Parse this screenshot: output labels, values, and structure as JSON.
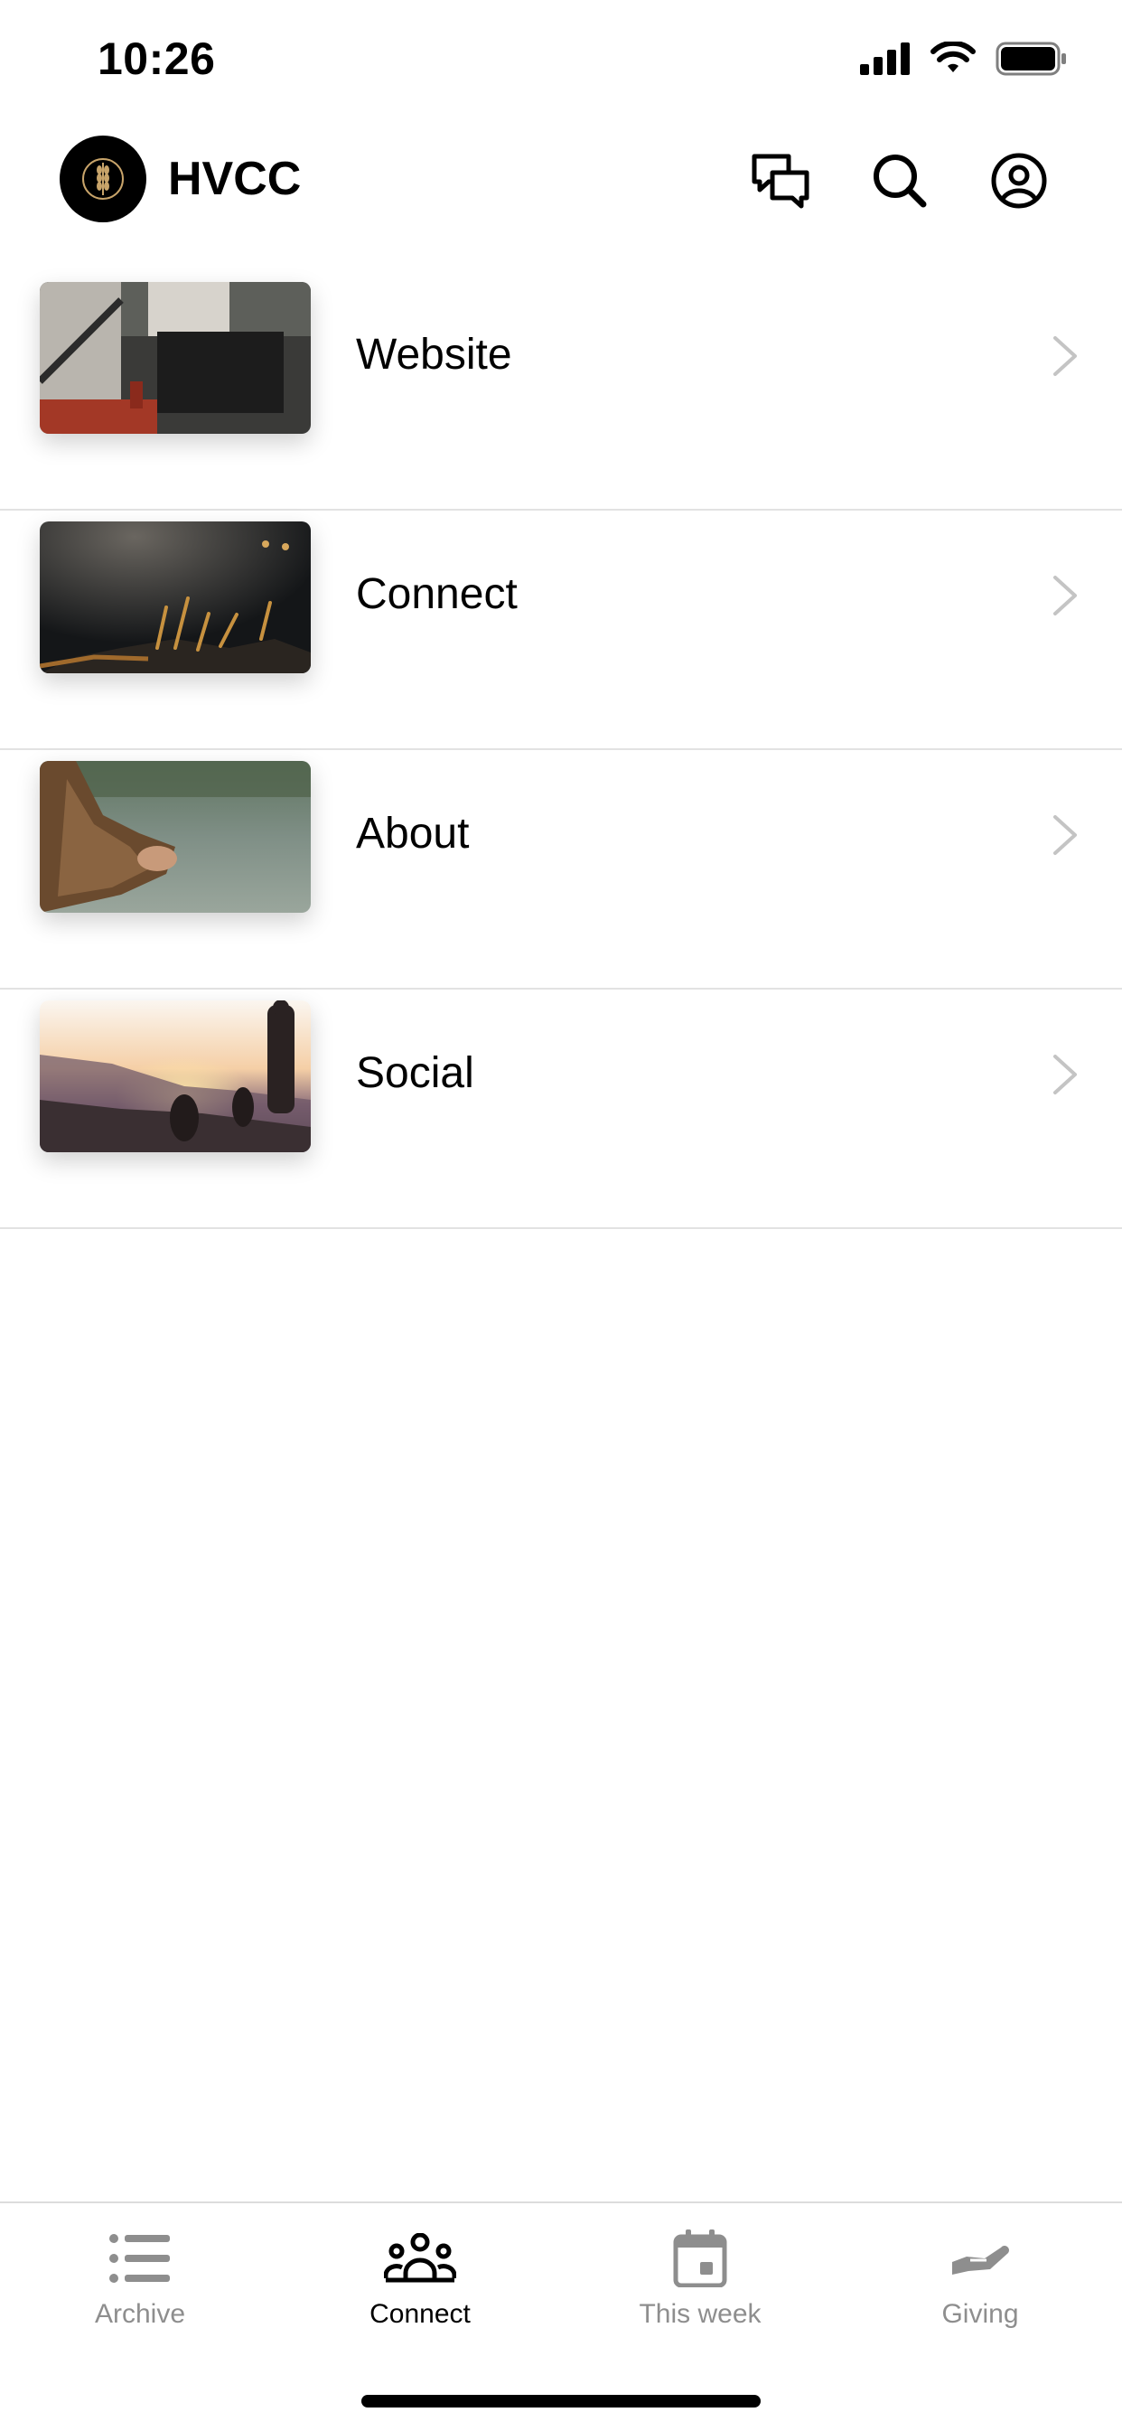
{
  "status_bar": {
    "time": "10:26"
  },
  "header": {
    "title": "HVCC"
  },
  "list": {
    "items": [
      {
        "label": "Website"
      },
      {
        "label": "Connect"
      },
      {
        "label": "About"
      },
      {
        "label": "Social"
      }
    ]
  },
  "tabbar": {
    "tabs": [
      {
        "label": "Archive",
        "icon": "list-icon",
        "active": false
      },
      {
        "label": "Connect",
        "icon": "people-icon",
        "active": true
      },
      {
        "label": "This week",
        "icon": "calendar-icon",
        "active": false
      },
      {
        "label": "Giving",
        "icon": "giving-hand-icon",
        "active": false
      }
    ]
  },
  "colors": {
    "active": "#000000",
    "inactive": "#8e8e8e",
    "divider": "#e2e2e2"
  }
}
